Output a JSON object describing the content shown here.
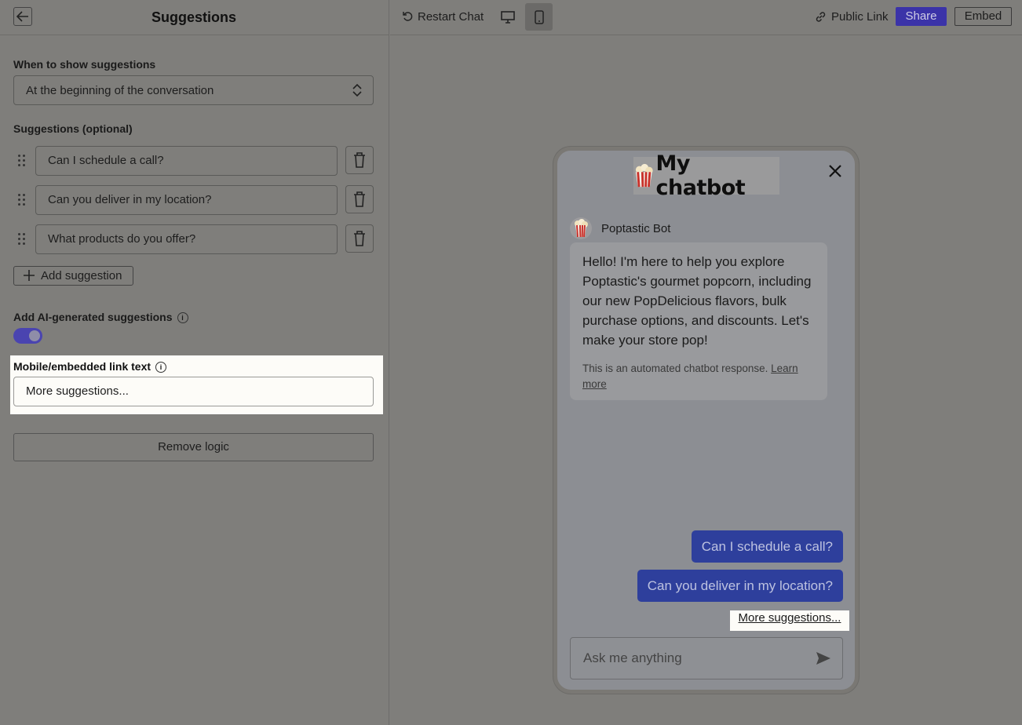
{
  "left_panel": {
    "title": "Suggestions",
    "when_label": "When to show suggestions",
    "when_value": "At the beginning of the conversation",
    "suggestions_label": "Suggestions (optional)",
    "suggestions": [
      "Can I schedule a call?",
      "Can you deliver in my location?",
      "What products do you offer?"
    ],
    "add_suggestion": "Add suggestion",
    "ai_label": "Add AI-generated suggestions",
    "ai_enabled": true,
    "mobile_link_label": "Mobile/embedded link text",
    "mobile_link_value": "More suggestions...",
    "remove_logic": "Remove logic"
  },
  "topbar": {
    "restart": "Restart Chat",
    "public_link": "Public Link",
    "share": "Share",
    "embed": "Embed",
    "active_device": "mobile"
  },
  "chat": {
    "logo_text": "My chatbot",
    "bot_name": "Poptastic Bot",
    "bot_message": "Hello! I'm here to help you explore Poptastic's gourmet popcorn, including our new PopDelicious flavors, bulk purchase options, and discounts. Let's make your store pop!",
    "bot_note_prefix": "This is an automated chatbot response. ",
    "bot_note_link": "Learn more",
    "user_suggestions": [
      "Can I schedule a call?",
      "Can you deliver in my location?"
    ],
    "more_suggestions": "More suggestions...",
    "input_placeholder": "Ask me anything"
  },
  "colors": {
    "accent": "#3b33a8",
    "user_bubble": "#2e3f9c",
    "highlight": "#fdfcf8"
  }
}
